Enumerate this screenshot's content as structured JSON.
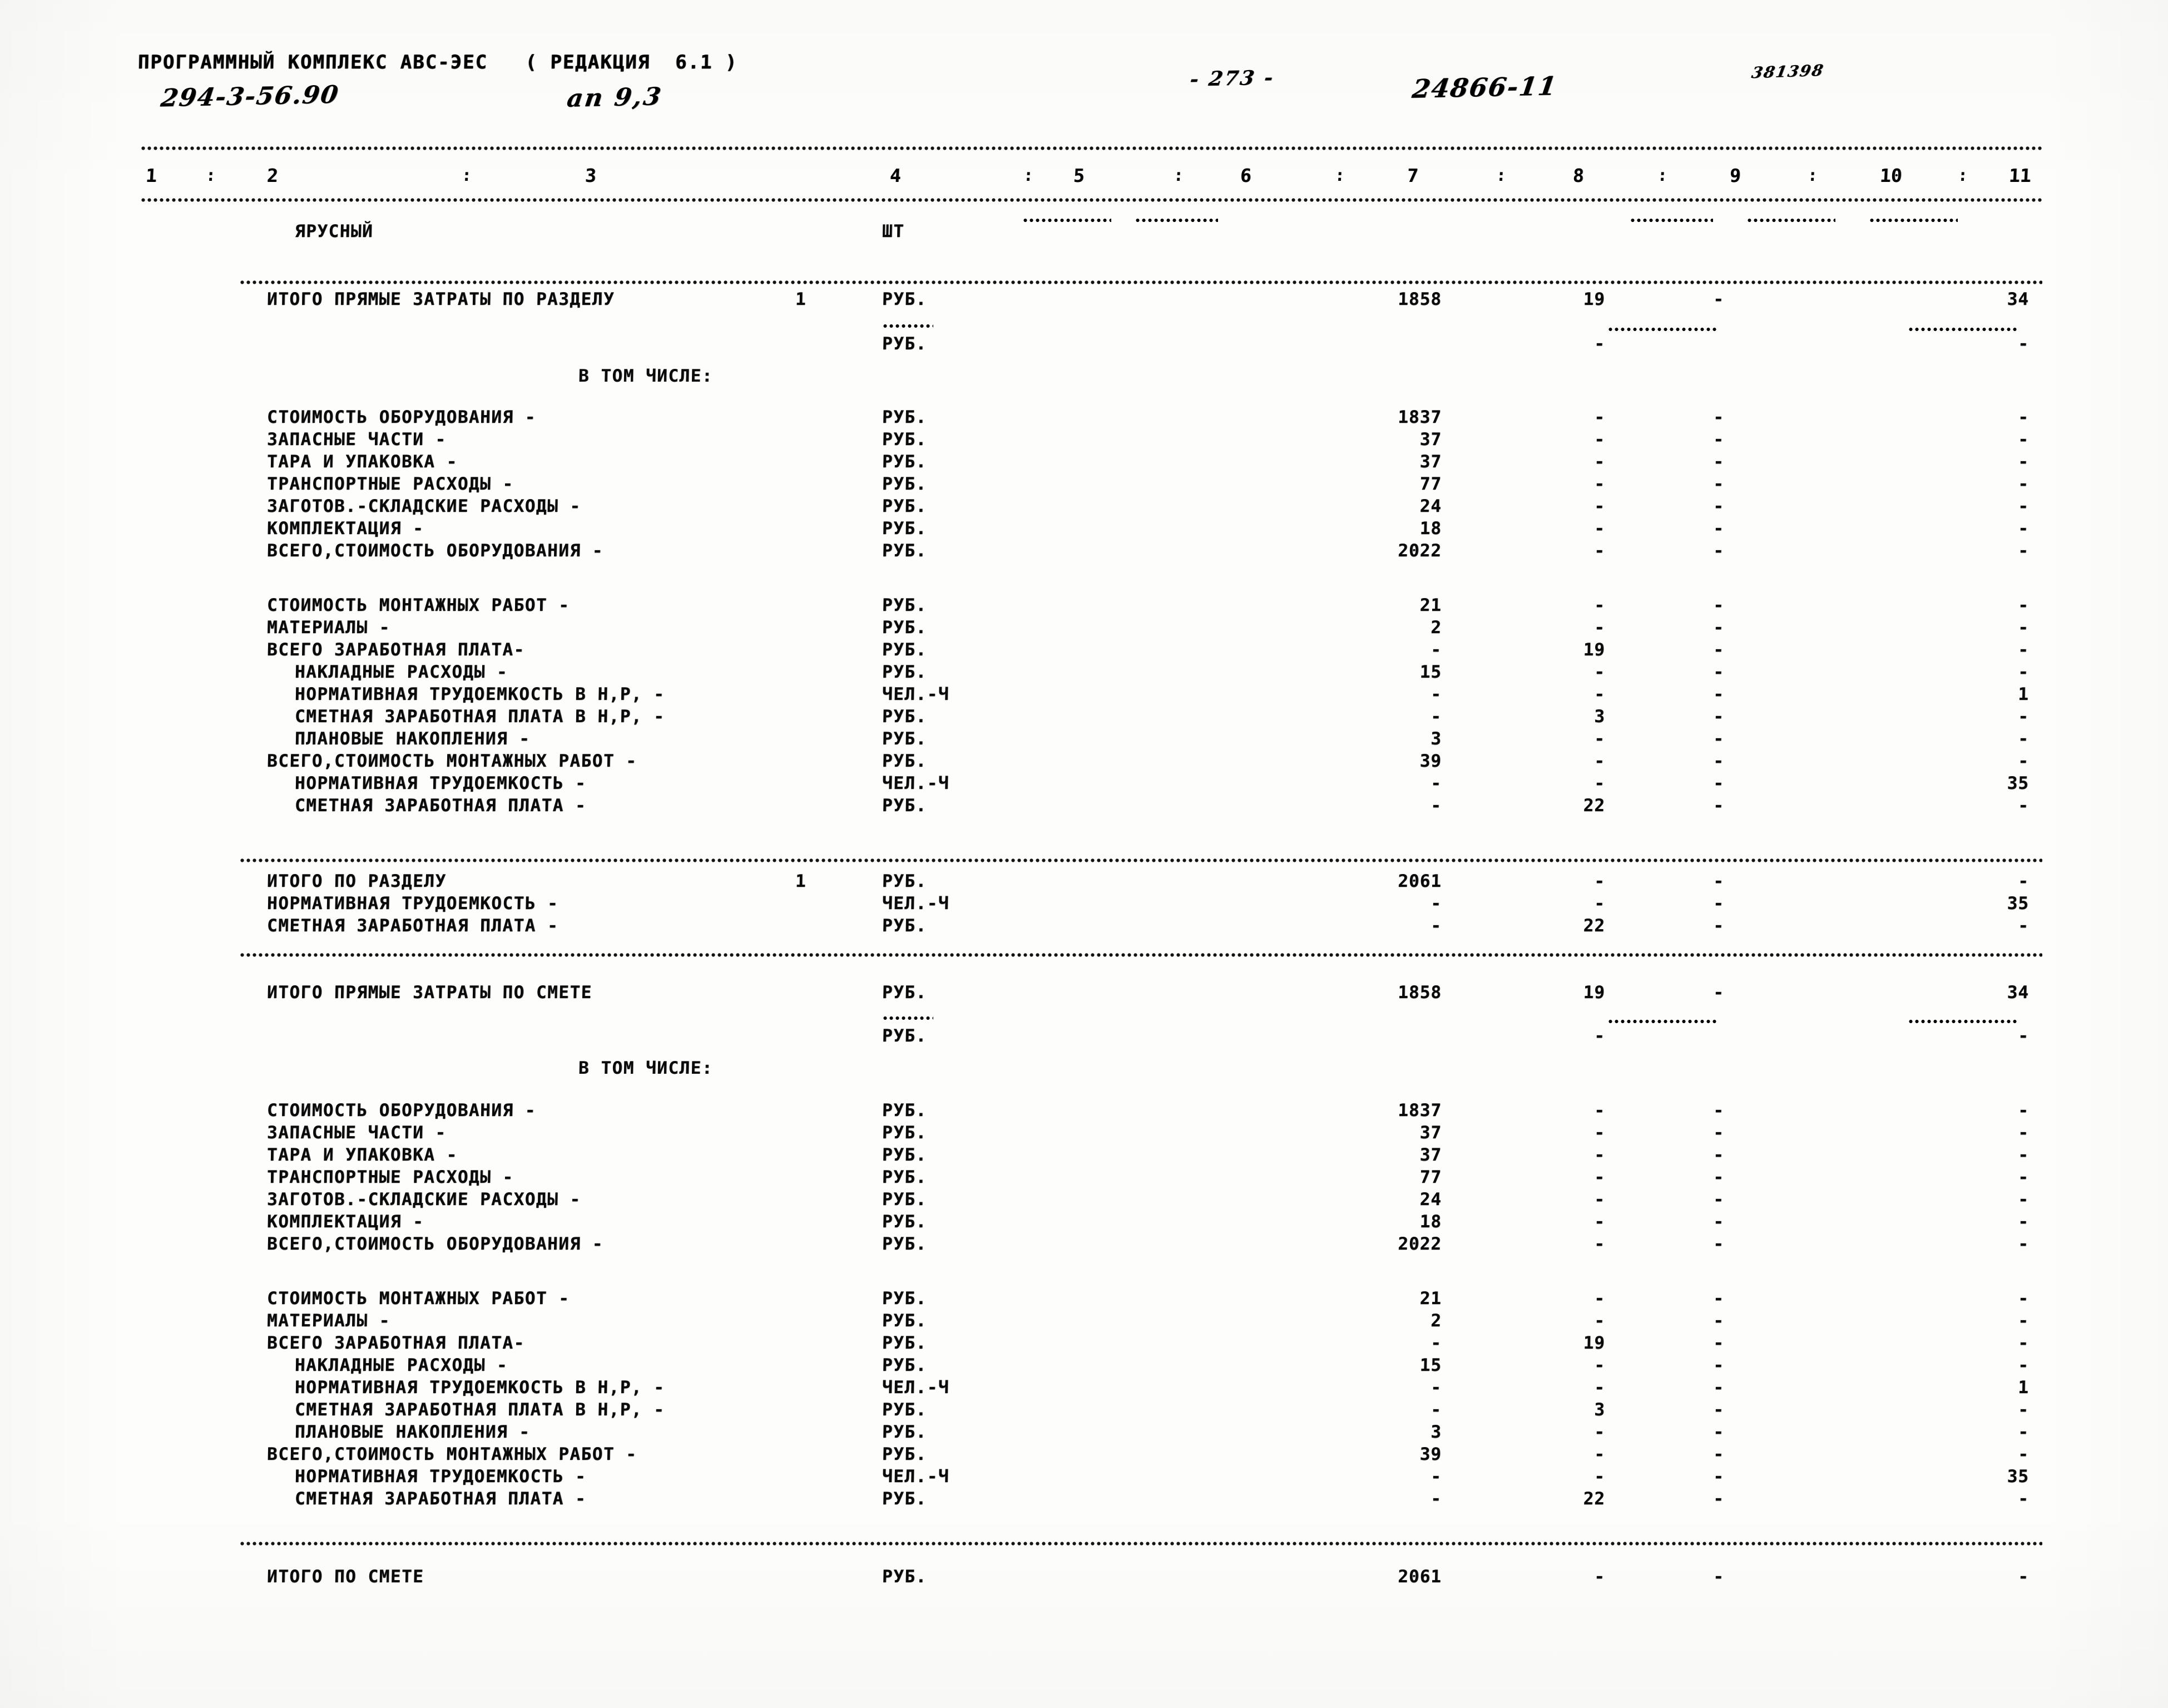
{
  "header": {
    "program": "ПРОГРАММНЫЙ КОМПЛЕКС АВС-ЭЕС   ( РЕДАКЦИЯ  6.1 )",
    "code": "294-3-56.90",
    "appendix": "ап 9,3",
    "page": "- 273 -",
    "doc_number": "24866-11",
    "serial": "381398"
  },
  "columns": {
    "numbers": [
      "1",
      "2",
      "3",
      "4",
      "5",
      "6",
      "7",
      "8",
      "9",
      "10",
      "11"
    ],
    "separator": ":"
  },
  "rows": [
    {
      "id": "yarusnyi",
      "label": "ЯРУСНЫЙ",
      "indent": 2,
      "unit": "ШТ",
      "c7": "",
      "c8": "",
      "c9": "",
      "c11": "",
      "dash7": true,
      "dash8": true,
      "dash9": true,
      "dash11": true
    },
    {
      "id": "itogo-pryamye-razdel",
      "label": "ИТОГО ПРЯМЫЕ ЗАТРАТЫ ПО РАЗДЕЛУ",
      "section_no": "1",
      "indent": 1,
      "unit": "РУБ.",
      "c7": "1858",
      "c8": "19",
      "c9": "-",
      "c11": "34"
    },
    {
      "id": "itogo-pryamye-razdel-cont",
      "label": "",
      "indent": 1,
      "unit": "РУБ.",
      "c7": "",
      "c8": "-",
      "c9": "",
      "c11": "-"
    },
    {
      "id": "v-tom-chisle-1",
      "label": "В ТОМ ЧИСЛЕ:",
      "center": true
    },
    {
      "id": "stoimost-oborudovaniya-1",
      "label": "СТОИМОСТЬ ОБОРУДОВАНИЯ -",
      "indent": 1,
      "unit": "РУБ.",
      "c7": "1837",
      "c8": "-",
      "c9": "-",
      "c11": "-"
    },
    {
      "id": "zapasnye-chasti-1",
      "label": "ЗАПАСНЫЕ ЧАСТИ -",
      "indent": 1,
      "unit": "РУБ.",
      "c7": "37",
      "c8": "-",
      "c9": "-",
      "c11": "-"
    },
    {
      "id": "tara-i-upakovka-1",
      "label": "ТАРА И УПАКОВКА -",
      "indent": 1,
      "unit": "РУБ.",
      "c7": "37",
      "c8": "-",
      "c9": "-",
      "c11": "-"
    },
    {
      "id": "transportnye-raskhody-1",
      "label": "ТРАНСПОРТНЫЕ РАСХОДЫ -",
      "indent": 1,
      "unit": "РУБ.",
      "c7": "77",
      "c8": "-",
      "c9": "-",
      "c11": "-"
    },
    {
      "id": "zagotov-skladskie-raskhody-1",
      "label": "ЗАГОТОВ.-СКЛАДСКИЕ РАСХОДЫ -",
      "indent": 1,
      "unit": "РУБ.",
      "c7": "24",
      "c8": "-",
      "c9": "-",
      "c11": "-"
    },
    {
      "id": "komplektaciya-1",
      "label": "КОМПЛЕКТАЦИЯ -",
      "indent": 1,
      "unit": "РУБ.",
      "c7": "18",
      "c8": "-",
      "c9": "-",
      "c11": "-"
    },
    {
      "id": "vsego-stoimost-oborudovaniya-1",
      "label": "ВСЕГО,СТОИМОСТЬ ОБОРУДОВАНИЯ -",
      "indent": 1,
      "unit": "РУБ.",
      "c7": "2022",
      "c8": "-",
      "c9": "-",
      "c11": "-"
    },
    {
      "id": "stoimost-montazhnykh-rabot-1",
      "label": "СТОИМОСТЬ МОНТАЖНЫХ РАБОТ -",
      "indent": 1,
      "unit": "РУБ.",
      "c7": "21",
      "c8": "-",
      "c9": "-",
      "c11": "-"
    },
    {
      "id": "materialy-1",
      "label": "МАТЕРИАЛЫ -",
      "indent": 1,
      "unit": "РУБ.",
      "c7": "2",
      "c8": "-",
      "c9": "-",
      "c11": "-"
    },
    {
      "id": "vsego-zarabotnaya-plata-1",
      "label": "ВСЕГО ЗАРАБОТНАЯ ПЛАТА-",
      "indent": 1,
      "unit": "РУБ.",
      "c7": "-",
      "c8": "19",
      "c9": "-",
      "c11": "-"
    },
    {
      "id": "nakladnye-raskhody-1",
      "label": "НАКЛАДНЫЕ РАСХОДЫ -",
      "indent": 2,
      "unit": "РУБ.",
      "c7": "15",
      "c8": "-",
      "c9": "-",
      "c11": "-"
    },
    {
      "id": "normativnaya-trudoemkost-nr-1",
      "label": "НОРМАТИВНАЯ ТРУДОЕМКОСТЬ В Н,Р, -",
      "indent": 2,
      "unit": "ЧЕЛ.-Ч",
      "c7": "-",
      "c8": "-",
      "c9": "-",
      "c11": "1"
    },
    {
      "id": "smetnaya-zarplata-nr-1",
      "label": "СМЕТНАЯ ЗАРАБОТНАЯ ПЛАТА В Н,Р, -",
      "indent": 2,
      "unit": "РУБ.",
      "c7": "-",
      "c8": "3",
      "c9": "-",
      "c11": "-"
    },
    {
      "id": "planovye-nakopleniya-1",
      "label": "ПЛАНОВЫЕ НАКОПЛЕНИЯ -",
      "indent": 2,
      "unit": "РУБ.",
      "c7": "3",
      "c8": "-",
      "c9": "-",
      "c11": "-"
    },
    {
      "id": "vsego-stoimost-montazh-1",
      "label": "ВСЕГО,СТОИМОСТЬ МОНТАЖНЫХ РАБОТ -",
      "indent": 1,
      "unit": "РУБ.",
      "c7": "39",
      "c8": "-",
      "c9": "-",
      "c11": "-"
    },
    {
      "id": "normativnaya-trudoemkost-1",
      "label": "НОРМАТИВНАЯ ТРУДОЕМКОСТЬ -",
      "indent": 2,
      "unit": "ЧЕЛ.-Ч",
      "c7": "-",
      "c8": "-",
      "c9": "-",
      "c11": "35"
    },
    {
      "id": "smetnaya-zarplata-1",
      "label": "СМЕТНАЯ ЗАРАБОТНАЯ ПЛАТА -",
      "indent": 2,
      "unit": "РУБ.",
      "c7": "-",
      "c8": "22",
      "c9": "-",
      "c11": "-"
    },
    {
      "id": "itogo-po-razdelu",
      "label": "ИТОГО ПО РАЗДЕЛУ",
      "section_no": "1",
      "indent": 1,
      "unit": "РУБ.",
      "c7": "2061",
      "c8": "-",
      "c9": "-",
      "c11": "-"
    },
    {
      "id": "itogo-razdel-trudoemkost",
      "label": "НОРМАТИВНАЯ ТРУДОЕМКОСТЬ -",
      "indent": 1,
      "unit": "ЧЕЛ.-Ч",
      "c7": "-",
      "c8": "-",
      "c9": "-",
      "c11": "35"
    },
    {
      "id": "itogo-razdel-zarplata",
      "label": "СМЕТНАЯ ЗАРАБОТНАЯ ПЛАТА -",
      "indent": 1,
      "unit": "РУБ.",
      "c7": "-",
      "c8": "22",
      "c9": "-",
      "c11": "-"
    },
    {
      "id": "itogo-pryamye-smeta",
      "label": "ИТОГО ПРЯМЫЕ ЗАТРАТЫ ПО СМЕТЕ",
      "indent": 1,
      "unit": "РУБ.",
      "c7": "1858",
      "c8": "19",
      "c9": "-",
      "c11": "34"
    },
    {
      "id": "itogo-pryamye-smeta-cont",
      "label": "",
      "indent": 1,
      "unit": "РУБ.",
      "c7": "",
      "c8": "-",
      "c9": "",
      "c11": "-"
    },
    {
      "id": "v-tom-chisle-2",
      "label": "В ТОМ ЧИСЛЕ:",
      "center": true
    },
    {
      "id": "stoimost-oborudovaniya-2",
      "label": "СТОИМОСТЬ ОБОРУДОВАНИЯ -",
      "indent": 1,
      "unit": "РУБ.",
      "c7": "1837",
      "c8": "-",
      "c9": "-",
      "c11": "-"
    },
    {
      "id": "zapasnye-chasti-2",
      "label": "ЗАПАСНЫЕ ЧАСТИ -",
      "indent": 1,
      "unit": "РУБ.",
      "c7": "37",
      "c8": "-",
      "c9": "-",
      "c11": "-"
    },
    {
      "id": "tara-i-upakovka-2",
      "label": "ТАРА И УПАКОВКА -",
      "indent": 1,
      "unit": "РУБ.",
      "c7": "37",
      "c8": "-",
      "c9": "-",
      "c11": "-"
    },
    {
      "id": "transportnye-raskhody-2",
      "label": "ТРАНСПОРТНЫЕ РАСХОДЫ -",
      "indent": 1,
      "unit": "РУБ.",
      "c7": "77",
      "c8": "-",
      "c9": "-",
      "c11": "-"
    },
    {
      "id": "zagotov-skladskie-raskhody-2",
      "label": "ЗАГОТОВ.-СКЛАДСКИЕ РАСХОДЫ -",
      "indent": 1,
      "unit": "РУБ.",
      "c7": "24",
      "c8": "-",
      "c9": "-",
      "c11": "-"
    },
    {
      "id": "komplektaciya-2",
      "label": "КОМПЛЕКТАЦИЯ -",
      "indent": 1,
      "unit": "РУБ.",
      "c7": "18",
      "c8": "-",
      "c9": "-",
      "c11": "-"
    },
    {
      "id": "vsego-stoimost-oborudovaniya-2",
      "label": "ВСЕГО,СТОИМОСТЬ ОБОРУДОВАНИЯ -",
      "indent": 1,
      "unit": "РУБ.",
      "c7": "2022",
      "c8": "-",
      "c9": "-",
      "c11": "-"
    },
    {
      "id": "stoimost-montazhnykh-rabot-2",
      "label": "СТОИМОСТЬ МОНТАЖНЫХ РАБОТ -",
      "indent": 1,
      "unit": "РУБ.",
      "c7": "21",
      "c8": "-",
      "c9": "-",
      "c11": "-"
    },
    {
      "id": "materialy-2",
      "label": "МАТЕРИАЛЫ -",
      "indent": 1,
      "unit": "РУБ.",
      "c7": "2",
      "c8": "-",
      "c9": "-",
      "c11": "-"
    },
    {
      "id": "vsego-zarabotnaya-plata-2",
      "label": "ВСЕГО ЗАРАБОТНАЯ ПЛАТА-",
      "indent": 1,
      "unit": "РУБ.",
      "c7": "-",
      "c8": "19",
      "c9": "-",
      "c11": "-"
    },
    {
      "id": "nakladnye-raskhody-2",
      "label": "НАКЛАДНЫЕ РАСХОДЫ -",
      "indent": 2,
      "unit": "РУБ.",
      "c7": "15",
      "c8": "-",
      "c9": "-",
      "c11": "-"
    },
    {
      "id": "normativnaya-trudoemkost-nr-2",
      "label": "НОРМАТИВНАЯ ТРУДОЕМКОСТЬ В Н,Р, -",
      "indent": 2,
      "unit": "ЧЕЛ.-Ч",
      "c7": "-",
      "c8": "-",
      "c9": "-",
      "c11": "1"
    },
    {
      "id": "smetnaya-zarplata-nr-2",
      "label": "СМЕТНАЯ ЗАРАБОТНАЯ ПЛАТА В Н,Р, -",
      "indent": 2,
      "unit": "РУБ.",
      "c7": "-",
      "c8": "3",
      "c9": "-",
      "c11": "-"
    },
    {
      "id": "planovye-nakopleniya-2",
      "label": "ПЛАНОВЫЕ НАКОПЛЕНИЯ -",
      "indent": 2,
      "unit": "РУБ.",
      "c7": "3",
      "c8": "-",
      "c9": "-",
      "c11": "-"
    },
    {
      "id": "vsego-stoimost-montazh-2",
      "label": "ВСЕГО,СТОИМОСТЬ МОНТАЖНЫХ РАБОТ -",
      "indent": 1,
      "unit": "РУБ.",
      "c7": "39",
      "c8": "-",
      "c9": "-",
      "c11": "-"
    },
    {
      "id": "normativnaya-trudoemkost-2",
      "label": "НОРМАТИВНАЯ ТРУДОЕМКОСТЬ -",
      "indent": 2,
      "unit": "ЧЕЛ.-Ч",
      "c7": "-",
      "c8": "-",
      "c9": "-",
      "c11": "35"
    },
    {
      "id": "smetnaya-zarplata-2",
      "label": "СМЕТНАЯ ЗАРАБОТНАЯ ПЛАТА -",
      "indent": 2,
      "unit": "РУБ.",
      "c7": "-",
      "c8": "22",
      "c9": "-",
      "c11": "-"
    },
    {
      "id": "itogo-po-smete",
      "label": "ИТОГО ПО СМЕТЕ",
      "indent": 1,
      "unit": "РУБ.",
      "c7": "2061",
      "c8": "-",
      "c9": "-",
      "c11": "-"
    }
  ]
}
